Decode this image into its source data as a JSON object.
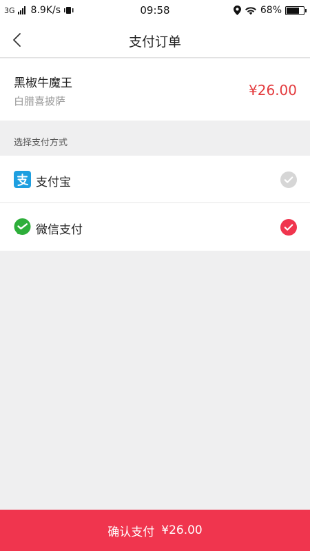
{
  "status_bar": {
    "network": "3G",
    "speed": "8.9K/s",
    "time": "09:58",
    "battery": "68%"
  },
  "nav": {
    "title": "支付订单"
  },
  "order": {
    "name": "黑椒牛魔王",
    "subtitle": "白腊喜披萨",
    "price": "¥26.00"
  },
  "payment": {
    "section_label": "选择支付方式",
    "methods": [
      {
        "label": "支付宝",
        "icon": "alipay-icon",
        "selected": false
      },
      {
        "label": "微信支付",
        "icon": "wechat-pay-icon",
        "selected": true
      }
    ]
  },
  "confirm": {
    "label": "确认支付",
    "amount": "¥26.00"
  },
  "colors": {
    "accent": "#f0354e",
    "price": "#e3393c",
    "alipay": "#1e9fe0",
    "wechat": "#2dae3a",
    "unchecked": "#d6d6d6"
  }
}
